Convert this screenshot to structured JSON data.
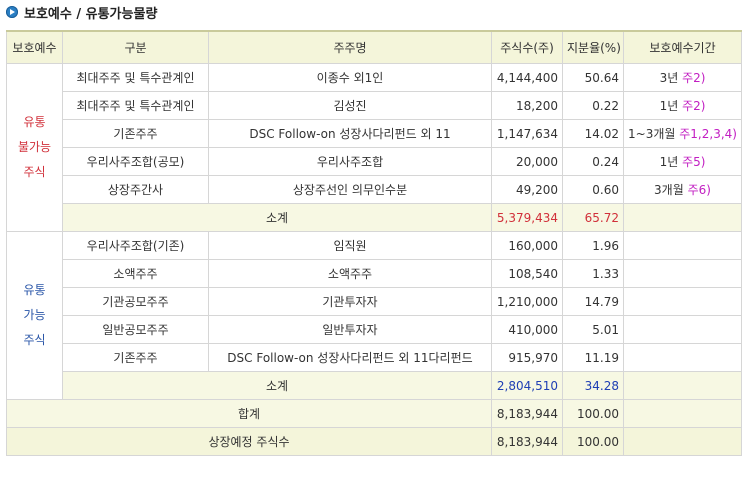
{
  "title": "보호예수 / 유통가능물량",
  "headers": [
    "보호예수",
    "구분",
    "주주명",
    "주식수(주)",
    "지분율(%)",
    "보호예수기간"
  ],
  "locked": {
    "label": "유통\n불가능\n주식",
    "rows": [
      {
        "category": "최대주주 및 특수관계인",
        "holder": "이종수 외1인",
        "shares": "4,144,400",
        "ratio": "50.64",
        "period": "3년",
        "note": "주2)"
      },
      {
        "category": "최대주주 및 특수관계인",
        "holder": "김성진",
        "shares": "18,200",
        "ratio": "0.22",
        "period": "1년",
        "note": "주2)"
      },
      {
        "category": "기존주주",
        "holder": "DSC Follow-on 성장사다리펀드 외 11",
        "shares": "1,147,634",
        "ratio": "14.02",
        "period": "1~3개월",
        "note": "주1,2,3,4)"
      },
      {
        "category": "우리사주조합(공모)",
        "holder": "우리사주조합",
        "shares": "20,000",
        "ratio": "0.24",
        "period": "1년",
        "note": "주5)"
      },
      {
        "category": "상장주간사",
        "holder": "상장주선인 의무인수분",
        "shares": "49,200",
        "ratio": "0.60",
        "period": "3개월",
        "note": "주6)"
      }
    ],
    "subtotal": {
      "label": "소계",
      "shares": "5,379,434",
      "ratio": "65.72"
    }
  },
  "tradable": {
    "label": "유통\n가능\n주식",
    "rows": [
      {
        "category": "우리사주조합(기존)",
        "holder": "임직원",
        "shares": "160,000",
        "ratio": "1.96"
      },
      {
        "category": "소액주주",
        "holder": "소액주주",
        "shares": "108,540",
        "ratio": "1.33"
      },
      {
        "category": "기관공모주주",
        "holder": "기관투자자",
        "shares": "1,210,000",
        "ratio": "14.79"
      },
      {
        "category": "일반공모주주",
        "holder": "일반투자자",
        "shares": "410,000",
        "ratio": "5.01"
      },
      {
        "category": "기존주주",
        "holder": "DSC Follow-on 성장사다리펀드 외 11다리펀드",
        "shares": "915,970",
        "ratio": "11.19"
      }
    ],
    "subtotal": {
      "label": "소계",
      "shares": "2,804,510",
      "ratio": "34.28"
    }
  },
  "total": {
    "label": "합계",
    "shares": "8,183,944",
    "ratio": "100.00"
  },
  "listed": {
    "label": "상장예정 주식수",
    "shares": "8,183,944",
    "ratio": "100.00"
  }
}
